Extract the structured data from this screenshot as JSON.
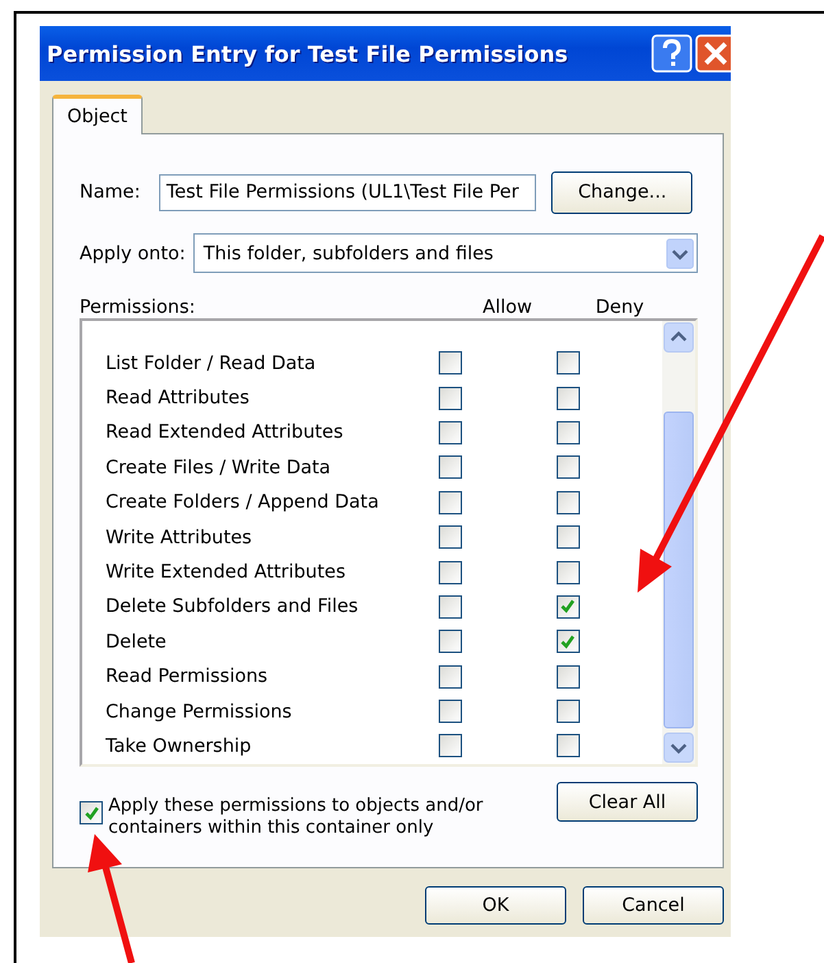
{
  "window": {
    "title": "Permission Entry for Test File Permissions"
  },
  "tabs": [
    {
      "label": "Object",
      "selected": true
    }
  ],
  "name": {
    "label": "Name:",
    "value": "Test File Permissions (UL1\\Test File Per",
    "button": "Change..."
  },
  "apply_onto": {
    "label": "Apply onto:",
    "value": "This folder, subfolders and files"
  },
  "permissions": {
    "label": "Permissions:",
    "columns": [
      "Allow",
      "Deny"
    ],
    "rows": [
      {
        "name": "List Folder / Read Data",
        "allow": false,
        "deny": false
      },
      {
        "name": "Read Attributes",
        "allow": false,
        "deny": false
      },
      {
        "name": "Read Extended Attributes",
        "allow": false,
        "deny": false
      },
      {
        "name": "Create Files / Write Data",
        "allow": false,
        "deny": false
      },
      {
        "name": "Create Folders / Append Data",
        "allow": false,
        "deny": false
      },
      {
        "name": "Write Attributes",
        "allow": false,
        "deny": false
      },
      {
        "name": "Write Extended Attributes",
        "allow": false,
        "deny": false
      },
      {
        "name": "Delete Subfolders and Files",
        "allow": false,
        "deny": true
      },
      {
        "name": "Delete",
        "allow": false,
        "deny": true
      },
      {
        "name": "Read Permissions",
        "allow": false,
        "deny": false
      },
      {
        "name": "Change Permissions",
        "allow": false,
        "deny": false
      },
      {
        "name": "Take Ownership",
        "allow": false,
        "deny": false
      }
    ]
  },
  "apply_checkbox": {
    "label": "Apply these permissions to objects and/or containers within this container only",
    "checked": true
  },
  "clear_button": "Clear All",
  "buttons": [
    "OK",
    "Cancel"
  ]
}
